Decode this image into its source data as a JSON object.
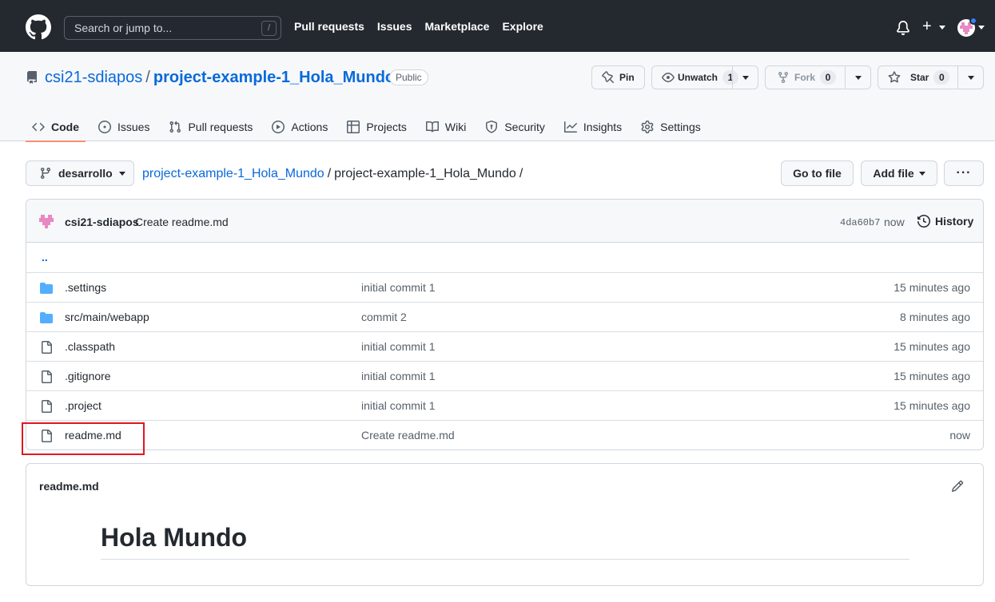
{
  "header": {
    "search_placeholder": "Search or jump to...",
    "search_shortcut": "/",
    "nav": [
      "Pull requests",
      "Issues",
      "Marketplace",
      "Explore"
    ],
    "plus_label": "+"
  },
  "repo": {
    "owner": "csi21-sdiapos",
    "separator": "/",
    "name": "project-example-1_Hola_Mundo",
    "visibility": "Public",
    "pin_label": "Pin",
    "unwatch_label": "Unwatch",
    "watch_count": "1",
    "fork_label": "Fork",
    "fork_count": "0",
    "star_label": "Star",
    "star_count": "0",
    "tabs": [
      {
        "label": "Code",
        "icon": "code-icon",
        "active": true
      },
      {
        "label": "Issues",
        "icon": "issue-icon"
      },
      {
        "label": "Pull requests",
        "icon": "pull-request-icon"
      },
      {
        "label": "Actions",
        "icon": "play-icon"
      },
      {
        "label": "Projects",
        "icon": "table-icon"
      },
      {
        "label": "Wiki",
        "icon": "book-icon"
      },
      {
        "label": "Security",
        "icon": "shield-icon"
      },
      {
        "label": "Insights",
        "icon": "graph-icon"
      },
      {
        "label": "Settings",
        "icon": "gear-icon"
      }
    ]
  },
  "filenav": {
    "branch": "desarrollo",
    "path_root": "project-example-1_Hola_Mundo",
    "path_current": "project-example-1_Hola_Mundo",
    "path_sep": "/",
    "go_to_file": "Go to file",
    "add_file": "Add file",
    "more": "···"
  },
  "commit": {
    "author": "csi21-sdiapos",
    "message": "Create readme.md",
    "sha": "4da60b7",
    "time": "now",
    "history_label": "History"
  },
  "files": {
    "parent": "..",
    "rows": [
      {
        "name": ".settings",
        "type": "dir",
        "message": "initial commit 1",
        "age": "15 minutes ago"
      },
      {
        "name": "src/main/webapp",
        "type": "dir",
        "message": "commit 2",
        "age": "8 minutes ago"
      },
      {
        "name": ".classpath",
        "type": "file",
        "message": "initial commit 1",
        "age": "15 minutes ago"
      },
      {
        "name": ".gitignore",
        "type": "file",
        "message": "initial commit 1",
        "age": "15 minutes ago"
      },
      {
        "name": ".project",
        "type": "file",
        "message": "initial commit 1",
        "age": "15 minutes ago"
      },
      {
        "name": "readme.md",
        "type": "file",
        "message": "Create readme.md",
        "age": "now"
      }
    ]
  },
  "readme": {
    "filename": "readme.md",
    "heading": "Hola Mundo"
  },
  "colors": {
    "header_bg": "#24292f",
    "link": "#0969da",
    "folder": "#54aeff",
    "active_tab_underline": "#fd8c73",
    "highlight_box": "#e3161f"
  }
}
